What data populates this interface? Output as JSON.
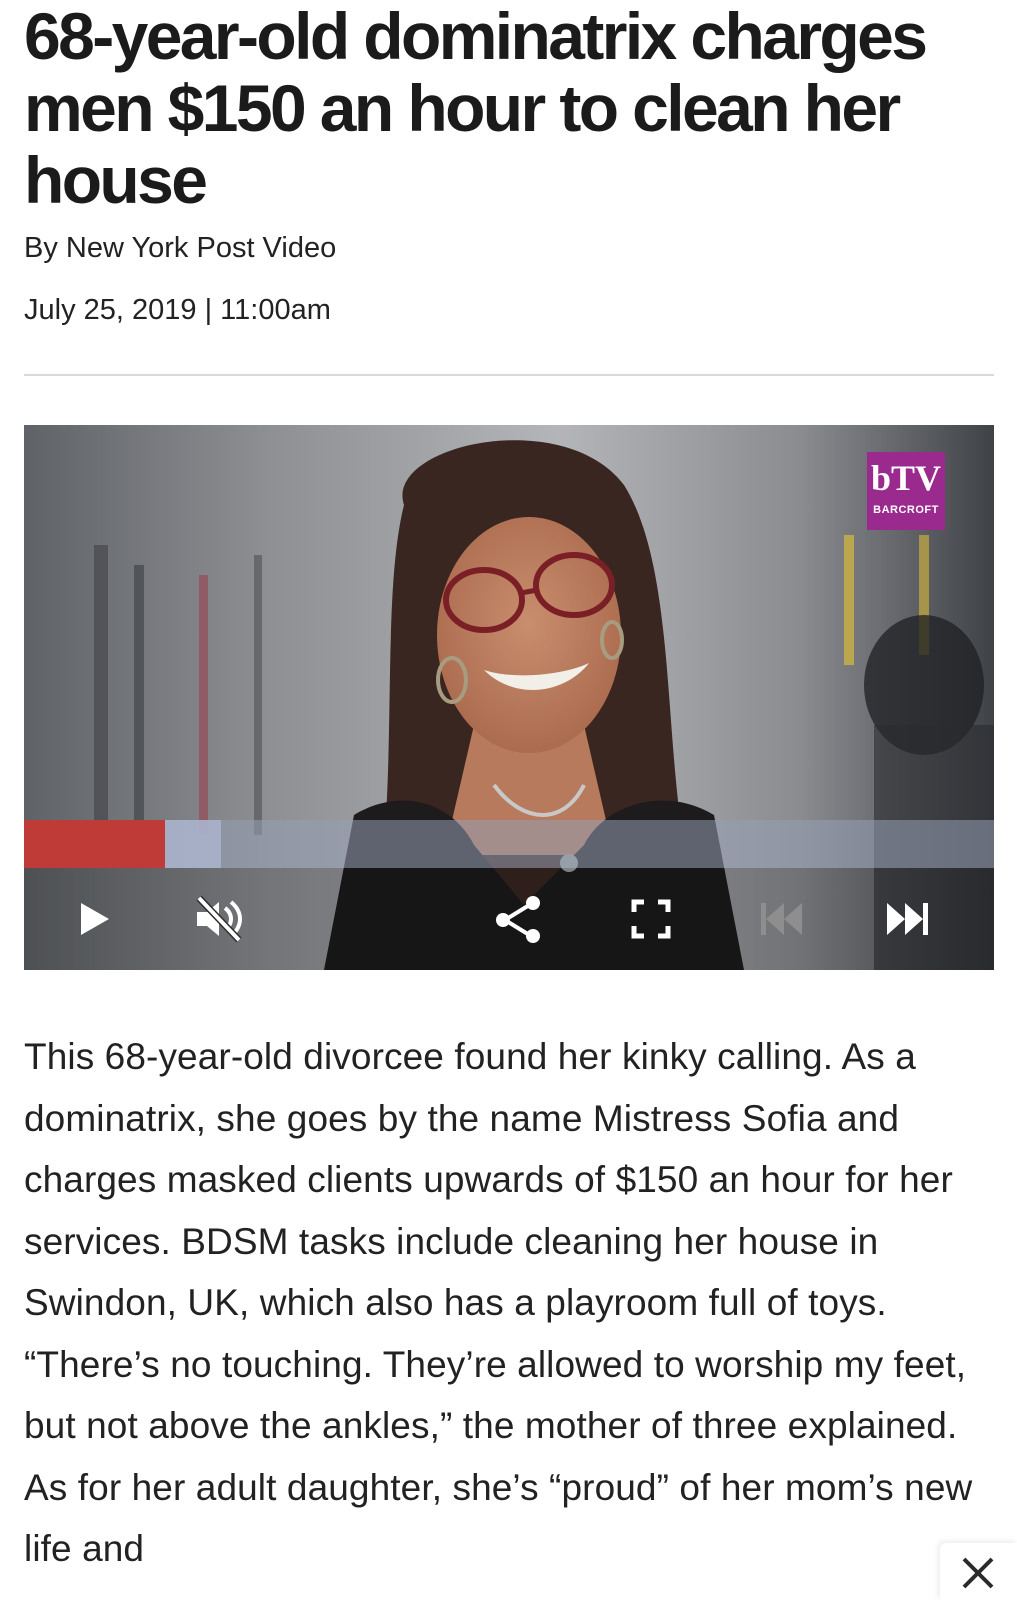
{
  "article": {
    "headline": "68-year-old dominatrix charges men $150 an hour to clean her house",
    "byline": "By New York Post Video",
    "date": "July 25, 2019 | 11:00am",
    "body": "This 68-year-old divorcee found her kinky calling. As a dominatrix, she goes by the name Mistress Sofia and charges masked clients upwards of $150 an hour for her services. BDSM tasks include cleaning her house in Swindon, UK, which also has a playroom full of toys. “There’s no touching. They’re allowed to worship my feet, but not above the ankles,” the mother of three explained. As for her adult daughter, she’s “proud” of her mom’s new life and"
  },
  "video": {
    "logo_mark": "bTV",
    "logo_name": "BARCROFT",
    "progress_played_fraction": 0.145,
    "progress_buffered_fraction": 0.203,
    "controls": [
      "play-icon",
      "mute-icon",
      "share-icon",
      "fullscreen-icon",
      "previous-icon",
      "next-icon"
    ]
  },
  "colors": {
    "progress_played": "#bf3b37",
    "logo_background": "#9b2a8f"
  },
  "overlay": {
    "close_icon": "close-icon"
  }
}
